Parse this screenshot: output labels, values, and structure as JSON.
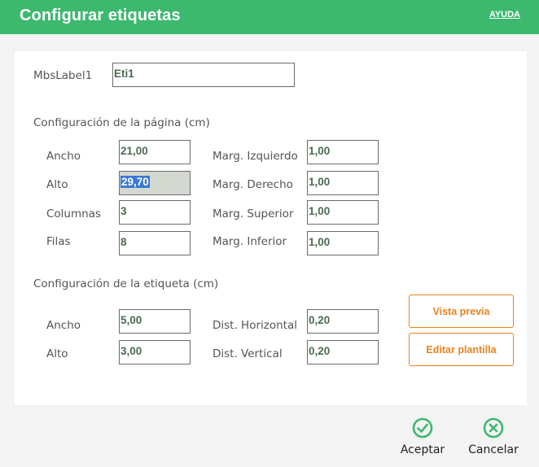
{
  "header": {
    "title": "Configurar etiquetas",
    "help": "AYUDA"
  },
  "label_name": {
    "label": "MbsLabel1",
    "value": "Eti1"
  },
  "page_section": {
    "title": "Configuración de la página (cm)",
    "ancho": {
      "label": "Ancho",
      "value": "21,00"
    },
    "alto": {
      "label": "Alto",
      "value": "29,70"
    },
    "columnas": {
      "label": "Columnas",
      "value": "3"
    },
    "filas": {
      "label": "Filas",
      "value": "8"
    },
    "marg_izquierdo": {
      "label": "Marg. Izquierdo",
      "value": "1,00"
    },
    "marg_derecho": {
      "label": "Marg. Derecho",
      "value": "1,00"
    },
    "marg_superior": {
      "label": "Marg. Superior",
      "value": "1,00"
    },
    "marg_inferior": {
      "label": "Marg. Inferior",
      "value": "1,00"
    }
  },
  "label_section": {
    "title": "Configuración de la etiqueta (cm)",
    "ancho": {
      "label": "Ancho",
      "value": "5,00"
    },
    "alto": {
      "label": "Alto",
      "value": "3,00"
    },
    "dist_horizontal": {
      "label": "Dist. Horizontal",
      "value": "0,20"
    },
    "dist_vertical": {
      "label": "Dist. Vertical",
      "value": "0,20"
    }
  },
  "buttons": {
    "preview": "Vista previa",
    "edit_template": "Editar plantilla"
  },
  "footer": {
    "accept": "Aceptar",
    "cancel": "Cancelar"
  },
  "colors": {
    "header": "#3cb96e",
    "accent": "#e8821e",
    "action_icon": "#3cb96e",
    "selection": "#3a78d8"
  },
  "icons": {
    "accept": "check-circle-icon",
    "cancel": "x-circle-icon"
  }
}
